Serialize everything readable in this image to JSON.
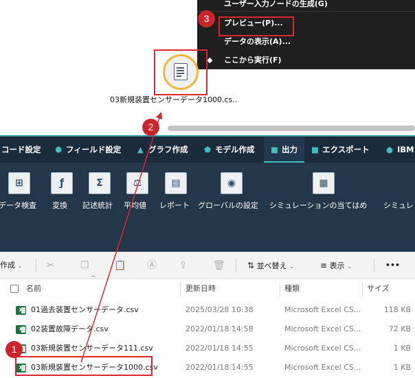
{
  "context_menu": {
    "items": [
      {
        "label": "ユーザー入力ノードの生成(G)"
      },
      {
        "label": "プレビュー(P)..."
      },
      {
        "label": "データの表示(A)..."
      },
      {
        "label": "ここから実行(F)",
        "icon": "run-from-here-icon"
      }
    ]
  },
  "canvas": {
    "node_label": "03新規装置センサーデータ1000.cs..",
    "node_icon": "csv-file-node-icon"
  },
  "ribbon": {
    "tabs": [
      {
        "label": "コード設定",
        "icon": ""
      },
      {
        "label": "フィールド設定",
        "icon": "hexagon-icon"
      },
      {
        "label": "グラフ作成",
        "icon": "triangle-icon"
      },
      {
        "label": "モデル作成",
        "icon": "pentagon-icon"
      },
      {
        "label": "出力",
        "icon": "square-icon"
      },
      {
        "label": "エクスポート",
        "icon": "square-icon"
      },
      {
        "label": "IBM®",
        "icon": "ibm-icon"
      }
    ],
    "active_tab": "出力",
    "tools": [
      {
        "label": "データ検査",
        "glyph": "⊞"
      },
      {
        "label": "変換",
        "glyph": "ƒ"
      },
      {
        "label": "記述統計",
        "glyph": "Σ"
      },
      {
        "label": "平均値",
        "glyph": "⚖"
      },
      {
        "label": "レポート",
        "glyph": "▤"
      },
      {
        "label": "グローバルの設定",
        "glyph": "◉"
      },
      {
        "label": "シミュレーションの当てはめ",
        "glyph": "▦"
      },
      {
        "label": "シミュレ",
        "glyph": ""
      }
    ]
  },
  "explorer": {
    "command_bar": {
      "create_label": "作成",
      "sort_label": "並べ替え",
      "view_label": "表示",
      "more_label": "•••"
    },
    "columns": [
      "名前",
      "更新日時",
      "種類",
      "サイズ"
    ],
    "files": [
      {
        "name": "01過去装置センサーデータ.csv",
        "modified": "2025/03/28 10:38",
        "type": "Microsoft Excel CS...",
        "size": "118 KB"
      },
      {
        "name": "02装置故障データ.csv",
        "modified": "2022/01/18 14:58",
        "type": "Microsoft Excel CS...",
        "size": "72 KB"
      },
      {
        "name": "03新規装置センサーデータ111.csv",
        "modified": "2022/01/18 14:55",
        "type": "Microsoft Excel CS...",
        "size": "1 KB"
      },
      {
        "name": "03新規装置センサーデータ1000.csv",
        "modified": "2022/01/18 14:55",
        "type": "Microsoft Excel CS...",
        "size": "1 KB"
      }
    ]
  },
  "annotations": {
    "step1": "1",
    "step2": "2",
    "step3": "3",
    "color": "#d9272d"
  }
}
